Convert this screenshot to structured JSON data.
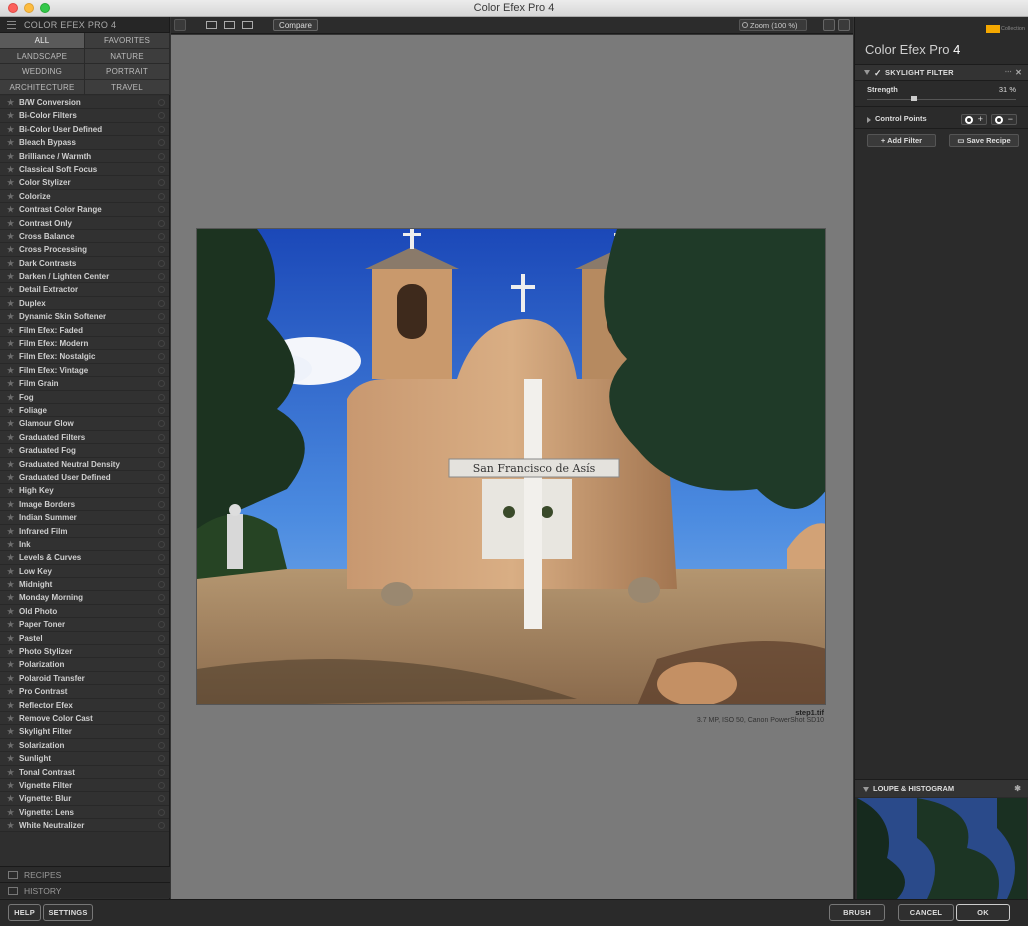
{
  "window": {
    "title": "Color Efex Pro 4"
  },
  "left_panel": {
    "header": "COLOR EFEX PRO 4",
    "categories": [
      "ALL",
      "FAVORITES",
      "LANDSCAPE",
      "NATURE",
      "WEDDING",
      "PORTRAIT",
      "ARCHITECTURE",
      "TRAVEL"
    ],
    "active_category": "ALL",
    "filters": [
      "B/W Conversion",
      "Bi-Color Filters",
      "Bi-Color User Defined",
      "Bleach Bypass",
      "Brilliance / Warmth",
      "Classical Soft Focus",
      "Color Stylizer",
      "Colorize",
      "Contrast Color Range",
      "Contrast Only",
      "Cross Balance",
      "Cross Processing",
      "Dark Contrasts",
      "Darken / Lighten Center",
      "Detail Extractor",
      "Duplex",
      "Dynamic Skin Softener",
      "Film Efex: Faded",
      "Film Efex: Modern",
      "Film Efex: Nostalgic",
      "Film Efex: Vintage",
      "Film Grain",
      "Fog",
      "Foliage",
      "Glamour Glow",
      "Graduated Filters",
      "Graduated Fog",
      "Graduated Neutral Density",
      "Graduated User Defined",
      "High Key",
      "Image Borders",
      "Indian Summer",
      "Infrared Film",
      "Ink",
      "Levels & Curves",
      "Low Key",
      "Midnight",
      "Monday Morning",
      "Old Photo",
      "Paper Toner",
      "Pastel",
      "Photo Stylizer",
      "Polarization",
      "Polaroid Transfer",
      "Pro Contrast",
      "Reflector Efex",
      "Remove Color Cast",
      "Skylight Filter",
      "Solarization",
      "Sunlight",
      "Tonal Contrast",
      "Vignette Filter",
      "Vignette: Blur",
      "Vignette: Lens",
      "White Neutralizer"
    ],
    "recipes_label": "RECIPES",
    "history_label": "HISTORY"
  },
  "toolbar": {
    "compare_label": "Compare",
    "zoom_label": "Zoom (100 %)"
  },
  "canvas": {
    "sign_text": "San Francisco de Asís",
    "file_name": "step1.tif",
    "file_info": "3.7 MP, ISO 50, Canon PowerShot SD10"
  },
  "right_panel": {
    "brand_collection": "Collection",
    "app_name": "Color Efex Pro",
    "app_version": "4",
    "filter_section": {
      "title": "SKYLIGHT FILTER",
      "strength_label": "Strength",
      "strength_value": "31 %",
      "strength_fraction": 0.31,
      "control_points_label": "Control Points"
    },
    "add_filter_label": "Add Filter",
    "save_recipe_label": "Save Recipe",
    "loupe_label": "LOUPE & HISTOGRAM"
  },
  "bottom_bar": {
    "help_label": "HELP",
    "settings_label": "SETTINGS",
    "brush_label": "BRUSH",
    "cancel_label": "CANCEL",
    "ok_label": "OK"
  }
}
